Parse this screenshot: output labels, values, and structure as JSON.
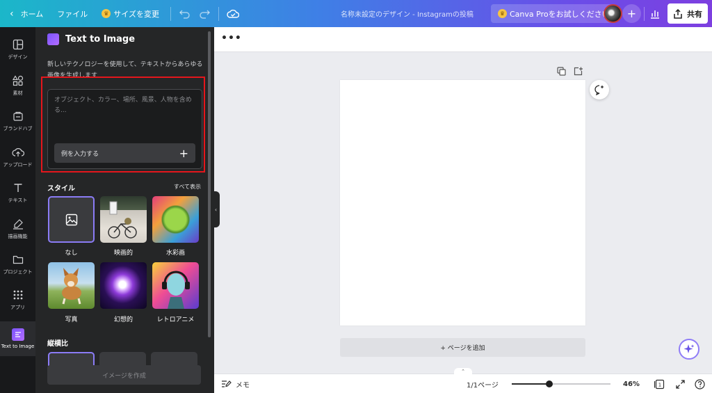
{
  "topbar": {
    "home": "ホーム",
    "file": "ファイル",
    "resize": "サイズを変更",
    "doc_title": "名称未設定のデザイン - Instagramの投稿",
    "pro_trial": "Canva Proをお試しください",
    "share": "共有"
  },
  "rail": {
    "items": [
      {
        "label": "デザイン"
      },
      {
        "label": "素材"
      },
      {
        "label": "ブランドハブ"
      },
      {
        "label": "アップロード"
      },
      {
        "label": "テキスト"
      },
      {
        "label": "描画機能"
      },
      {
        "label": "プロジェクト"
      },
      {
        "label": "アプリ"
      },
      {
        "label": "Text to Image"
      }
    ]
  },
  "panel": {
    "title": "Text to Image",
    "description": "新しいテクノロジーを使用して、テキストからあらゆる画像を生成します",
    "prompt_placeholder": "オブジェクト、カラー、場所、風景、人物を含める...",
    "example_button": "例を入力する",
    "style_title": "スタイル",
    "show_all": "すべて表示",
    "styles": [
      {
        "label": "なし"
      },
      {
        "label": "映画的"
      },
      {
        "label": "水彩画"
      },
      {
        "label": "写真"
      },
      {
        "label": "幻想的"
      },
      {
        "label": "レトロアニメ"
      }
    ],
    "aspect_title": "縦横比",
    "create_button": "イメージを作成"
  },
  "canvas": {
    "add_page": "+ ページを追加"
  },
  "bottombar": {
    "memo": "メモ",
    "pages": "1/1ページ",
    "zoom": "46%",
    "page_count": "1",
    "zoom_fraction": 0.38
  },
  "colors": {
    "accent": "#8b7cf6",
    "highlight": "#e5161c"
  }
}
